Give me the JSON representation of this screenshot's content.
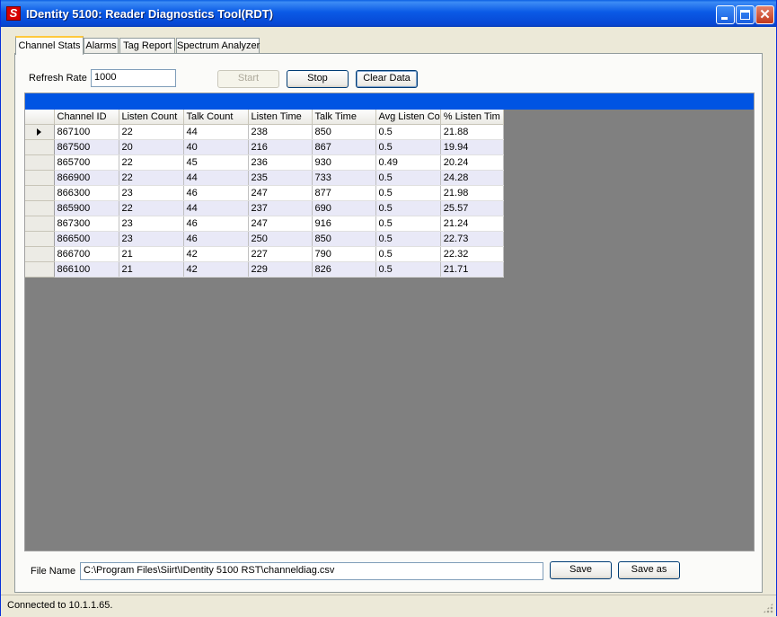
{
  "window": {
    "title": "IDentity 5100: Reader Diagnostics Tool(RDT)"
  },
  "tabs": [
    {
      "label": "Channel Stats",
      "active": true
    },
    {
      "label": "Alarms"
    },
    {
      "label": "Tag Report"
    },
    {
      "label": "Spectrum Analyzer"
    }
  ],
  "controls": {
    "refresh_rate_label": "Refresh Rate",
    "refresh_rate_value": "1000",
    "start_label": "Start",
    "stop_label": "Stop",
    "clear_label": "Clear Data"
  },
  "grid": {
    "columns": [
      "Channel ID",
      "Listen Count",
      "Talk Count",
      "Listen Time",
      "Talk Time",
      "Avg Listen Co",
      "% Listen Tim"
    ],
    "rows": [
      [
        "867100",
        "22",
        "44",
        "238",
        "850",
        "0.5",
        "21.88"
      ],
      [
        "867500",
        "20",
        "40",
        "216",
        "867",
        "0.5",
        "19.94"
      ],
      [
        "865700",
        "22",
        "45",
        "236",
        "930",
        "0.49",
        "20.24"
      ],
      [
        "866900",
        "22",
        "44",
        "235",
        "733",
        "0.5",
        "24.28"
      ],
      [
        "866300",
        "23",
        "46",
        "247",
        "877",
        "0.5",
        "21.98"
      ],
      [
        "865900",
        "22",
        "44",
        "237",
        "690",
        "0.5",
        "25.57"
      ],
      [
        "867300",
        "23",
        "46",
        "247",
        "916",
        "0.5",
        "21.24"
      ],
      [
        "866500",
        "23",
        "46",
        "250",
        "850",
        "0.5",
        "22.73"
      ],
      [
        "866700",
        "21",
        "42",
        "227",
        "790",
        "0.5",
        "22.32"
      ],
      [
        "866100",
        "21",
        "42",
        "229",
        "826",
        "0.5",
        "21.71"
      ]
    ],
    "current_row": 0
  },
  "file": {
    "label": "File Name",
    "path": "C:\\Program Files\\Siirt\\IDentity 5100 RST\\channeldiag.csv",
    "save_label": "Save",
    "save_as_label": "Save as"
  },
  "status": {
    "text": "Connected to 10.1.1.65."
  },
  "icons": {
    "app": "app-logo-icon",
    "minimize": "minimize-icon",
    "maximize": "maximize-icon",
    "close": "close-icon",
    "row_marker": "current-row-arrow-icon",
    "grip": "resize-grip-icon"
  },
  "colors": {
    "title_bar": "#0a5ae6",
    "grid_caption": "#0054e3",
    "grid_background": "#808080",
    "alt_row": "#e9e9f7"
  }
}
